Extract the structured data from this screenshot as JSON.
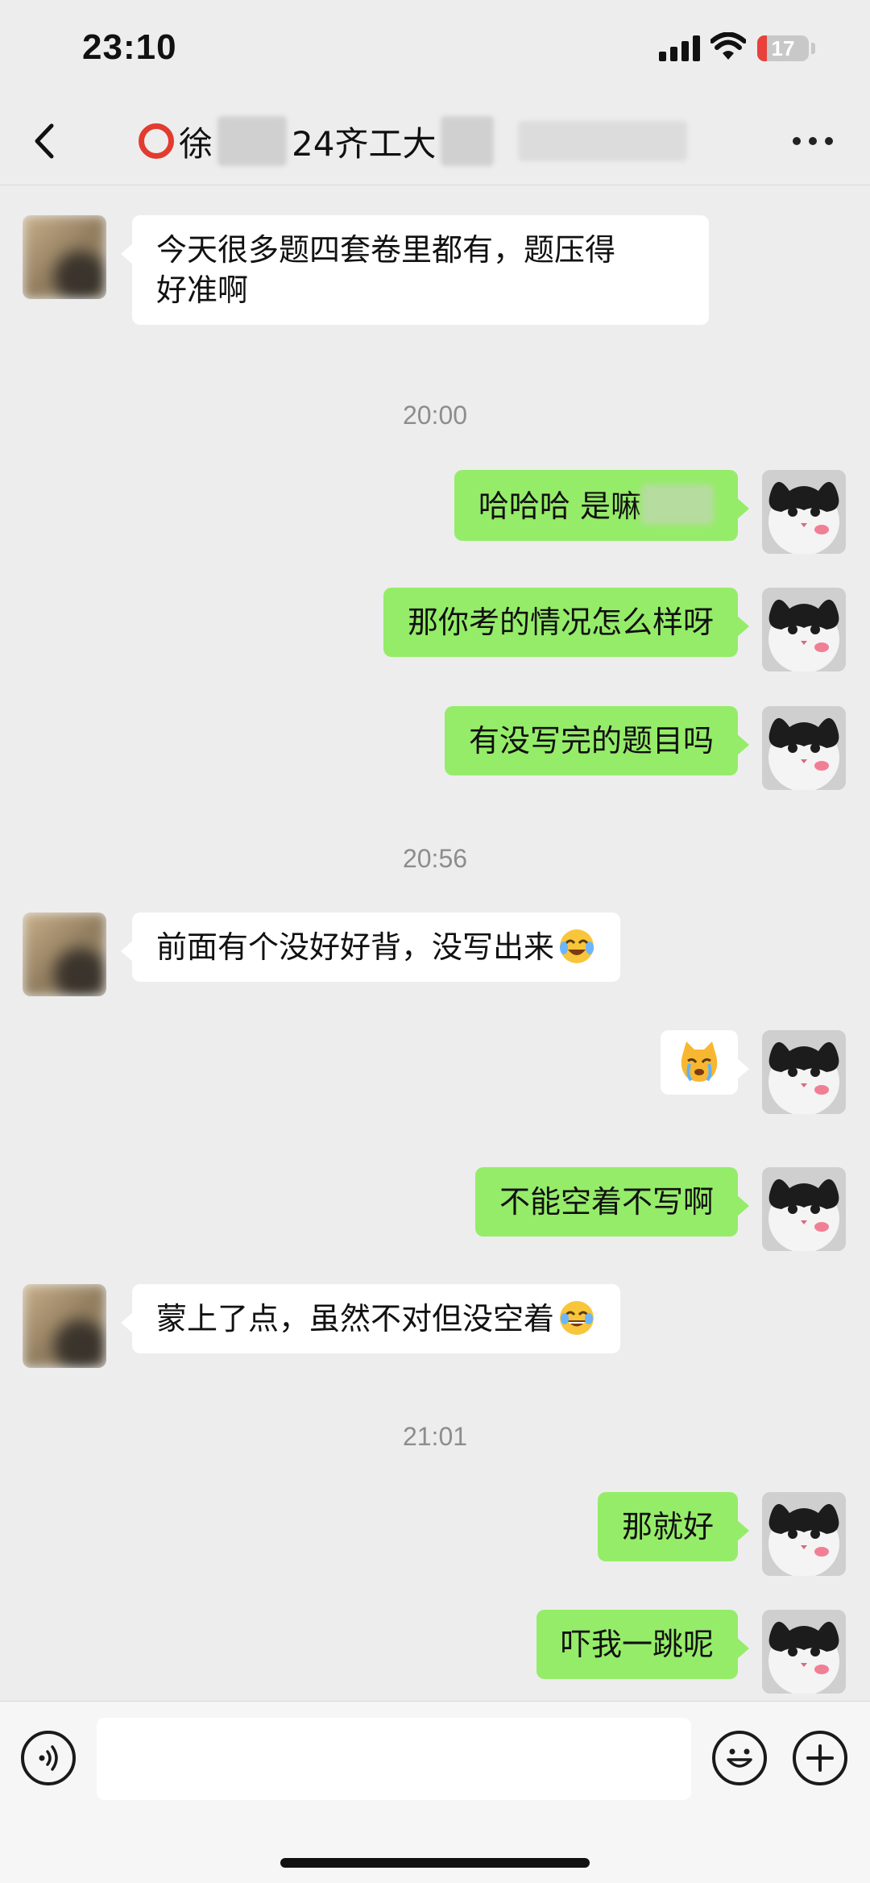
{
  "status_bar": {
    "time": "23:10",
    "battery_level": "17"
  },
  "header": {
    "title_part1": "徐",
    "title_part2": "24齐工大"
  },
  "messages": [
    {
      "id": "m1",
      "side": "left",
      "text": "今天很多题四套卷里都有，题压得\n好准啊"
    },
    {
      "id": "t1",
      "type": "time",
      "text": "20:00"
    },
    {
      "id": "m2",
      "side": "right",
      "text": "哈哈哈 是嘛"
    },
    {
      "id": "m3",
      "side": "right",
      "text": "那你考的情况怎么样呀"
    },
    {
      "id": "m4",
      "side": "right",
      "text": "有没写完的题目吗"
    },
    {
      "id": "t2",
      "type": "time",
      "text": "20:56"
    },
    {
      "id": "m5",
      "side": "left",
      "text": "前面有个没好好背，没写出来",
      "emoji": "laughing-crying-emoji"
    },
    {
      "id": "m6",
      "side": "right",
      "type": "sticker",
      "emoji": "crying-cat-sticker"
    },
    {
      "id": "m7",
      "side": "right",
      "text": "不能空着不写啊"
    },
    {
      "id": "m8",
      "side": "left",
      "text": "蒙上了点，虽然不对但没空着",
      "emoji": "tears-of-joy-emoji"
    },
    {
      "id": "t3",
      "type": "time",
      "text": "21:01"
    },
    {
      "id": "m9",
      "side": "right",
      "text": "那就好"
    },
    {
      "id": "m10",
      "side": "right",
      "text": "吓我一跳呢"
    }
  ],
  "input_bar": {
    "placeholder": ""
  },
  "colors": {
    "bubble_mine": "#95ec69",
    "bubble_other": "#ffffff",
    "background": "#ededed"
  },
  "icons": [
    "back-chevron-icon",
    "more-icon",
    "voice-icon",
    "emoji-icon",
    "plus-icon"
  ]
}
